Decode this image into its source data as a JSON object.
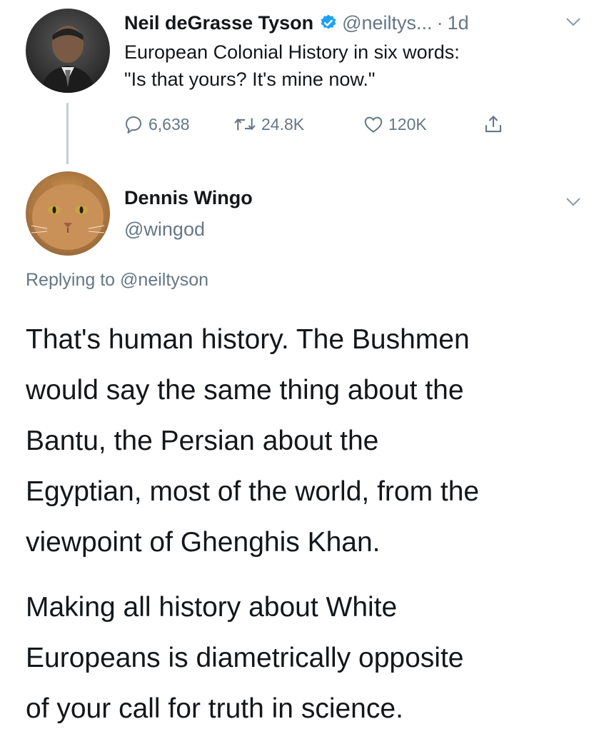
{
  "original_tweet": {
    "author_name": "Neil deGrasse Tyson",
    "handle": "@neiltys...",
    "separator": "·",
    "time": "1d",
    "text_lines": [
      "European Colonial History in six words:",
      "\"Is that yours? It's mine now.\""
    ],
    "actions": {
      "replies": "6,638",
      "retweets": "24.8K",
      "likes": "120K"
    },
    "icons": [
      "verified-badge-icon",
      "chevron-down-icon",
      "reply-icon",
      "retweet-icon",
      "like-icon",
      "share-icon"
    ]
  },
  "reply_tweet": {
    "author_name": "Dennis Wingo",
    "handle": "@wingod",
    "replying_prefix": "Replying to",
    "replying_mention": "@neiltyson",
    "paragraph1_lines": [
      "That's human history.  The Bushmen",
      "would say the same thing about the",
      "Bantu, the Persian about the",
      "Egyptian, most of the world, from the",
      "viewpoint of Ghenghis Khan."
    ],
    "paragraph2_lines": [
      "Making all history about White",
      "Europeans is diametrically opposite",
      "of your call for truth in science."
    ]
  },
  "colors": {
    "text_primary": "#14171a",
    "text_secondary": "#657786",
    "verified_blue": "#1da1f2",
    "thread_line": "#c4cfd6"
  }
}
